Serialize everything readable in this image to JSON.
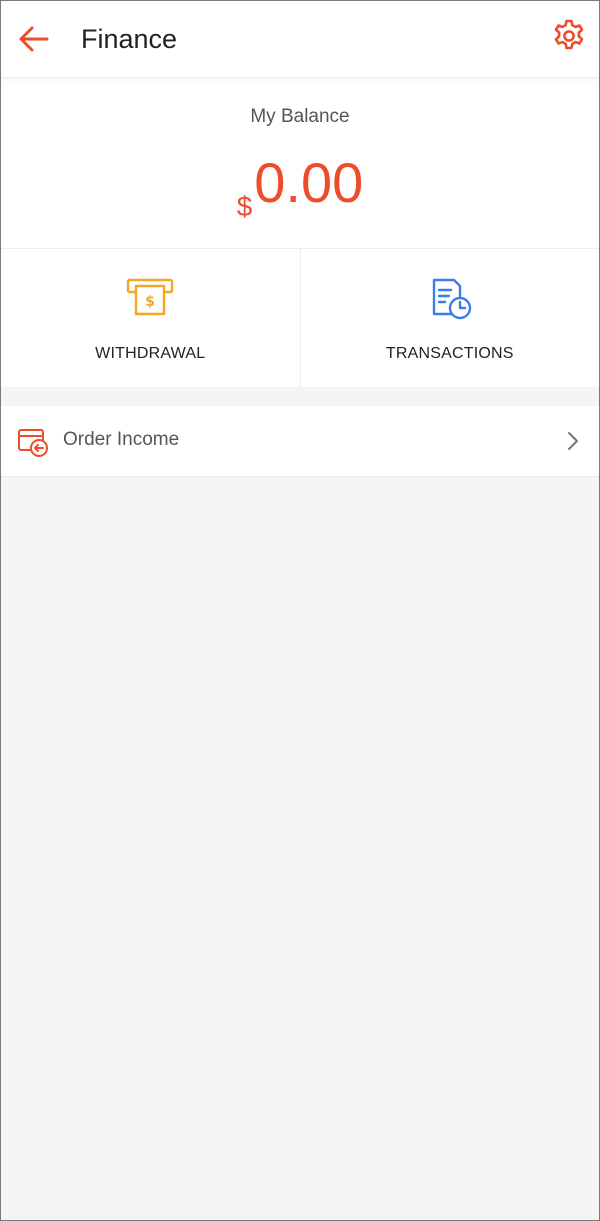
{
  "header": {
    "title": "Finance",
    "back_icon": "arrow-left-icon",
    "settings_icon": "gear-icon"
  },
  "balance": {
    "label": "My Balance",
    "currency": "$",
    "amount": "0.00"
  },
  "actions": [
    {
      "label": "WITHDRAWAL",
      "icon": "atm-withdrawal-icon",
      "color": "#f5a623"
    },
    {
      "label": "TRANSACTIONS",
      "icon": "document-clock-icon",
      "color": "#3a7ee6"
    }
  ],
  "menu": [
    {
      "label": "Order Income",
      "icon": "card-arrow-in-icon"
    }
  ],
  "colors": {
    "accent": "#ee4d2d",
    "background": "#f4f4f4"
  }
}
